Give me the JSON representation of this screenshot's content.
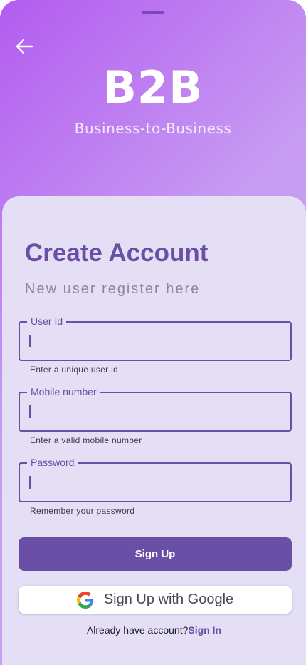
{
  "header": {
    "brand": "B2B",
    "tagline": "Business-to-Business"
  },
  "form": {
    "title": "Create Account",
    "subtitle": "New user register here",
    "fields": [
      {
        "label": "User Id",
        "value": "",
        "helper": "Enter a unique user id"
      },
      {
        "label": "Mobile number",
        "value": "",
        "helper": "Enter a valid mobile number"
      },
      {
        "label": "Password",
        "value": "",
        "helper": "Remember your password"
      }
    ],
    "signup_label": "Sign Up",
    "google_label": "Sign Up with Google",
    "have_account_text": "Already have account?",
    "signin_label": "Sign In"
  },
  "colors": {
    "primary": "#6a4fa6",
    "card": "#e5dff5",
    "gradient_start": "#b35cf0",
    "gradient_end": "#c9a9f1"
  },
  "icons": {
    "back": "arrow-left-icon",
    "google": "google-g-icon"
  }
}
